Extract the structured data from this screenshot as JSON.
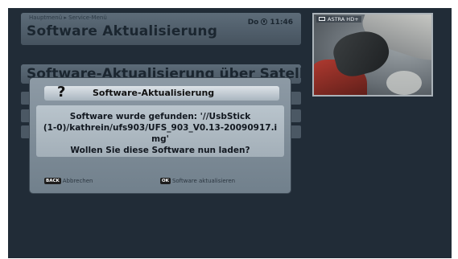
{
  "header": {
    "breadcrumb": "Hauptmenü  ▸  Service-Menü",
    "title": "Software Aktualisierung",
    "day": "Do",
    "time": "11:46"
  },
  "preview": {
    "channel": "ASTRA HD+"
  },
  "menu": {
    "title": "Software-Aktualisierung über Satellit"
  },
  "dialog": {
    "icon": "?",
    "title": "Software-Aktualisierung",
    "message": "Software wurde gefunden: '//UsbStick\n(1-0)/kathrein/ufs903/UFS_903_V0.13-20090917.i\nmg'\nWollen Sie diese Software nun laden?",
    "cancel_key": "BACK",
    "cancel_label": "Abbrechen",
    "confirm_key": "OK",
    "confirm_label": "Software aktualisieren"
  }
}
